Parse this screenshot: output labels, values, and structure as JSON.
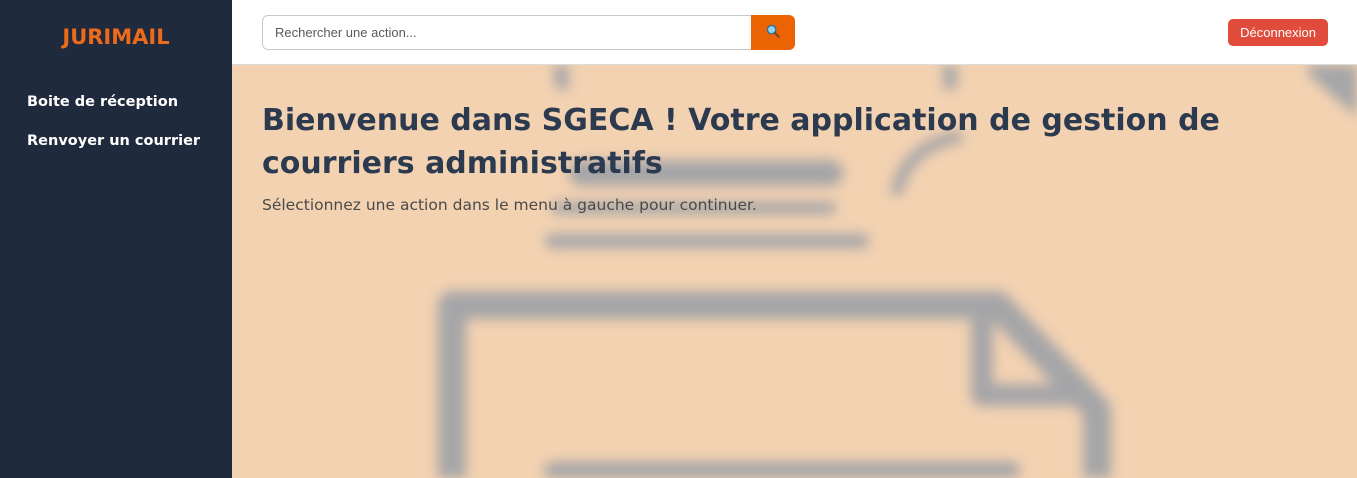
{
  "app": {
    "brand": "JURIMAIL",
    "colors": {
      "sidebar_bg": "#1f2b3d",
      "accent": "#ec6304",
      "logout": "#e14b3b",
      "content_bg": "#f3d2b2",
      "title": "#2c3a4f"
    }
  },
  "sidebar": {
    "items": [
      {
        "label": "Boite de réception"
      },
      {
        "label": "Renvoyer un courrier"
      }
    ]
  },
  "topbar": {
    "search": {
      "placeholder": "Rechercher une action...",
      "value": "",
      "button_icon": "search-icon"
    },
    "logout_label": "Déconnexion"
  },
  "main": {
    "title": "Bienvenue dans SGECA ! Votre application de gestion de courriers administratifs",
    "subtitle": "Sélectionnez une action dans le menu à gauche pour continuer.",
    "background_icon": "mail-document-illustration"
  }
}
